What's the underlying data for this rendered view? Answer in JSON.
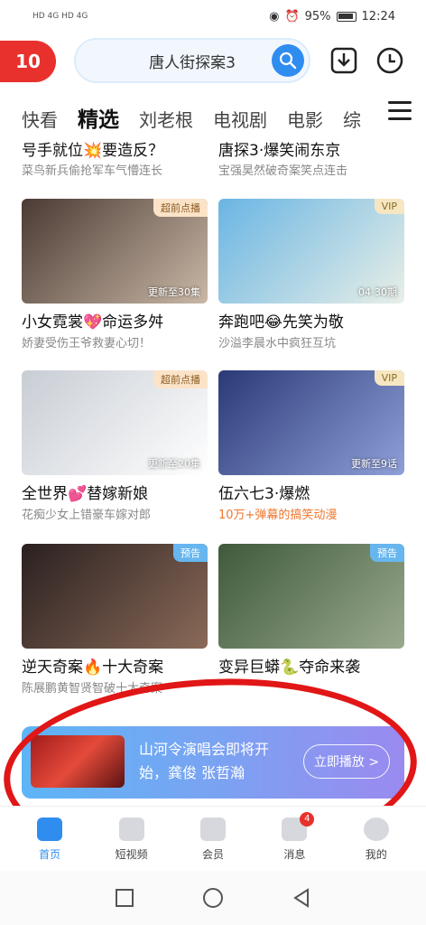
{
  "status_bar": {
    "signal_left": "HD 4G HD 4G",
    "battery_percent": "95%",
    "time": "12:24"
  },
  "header": {
    "logo_text": "10",
    "search_value": "唐人街探案3",
    "download_icon": "download-icon",
    "history_icon": "clock-icon"
  },
  "tabs": [
    {
      "label": "快看",
      "active": false
    },
    {
      "label": "精选",
      "active": true
    },
    {
      "label": "刘老根",
      "active": false
    },
    {
      "label": "电视剧",
      "active": false
    },
    {
      "label": "电影",
      "active": false
    },
    {
      "label": "综",
      "active": false
    }
  ],
  "partial_row": [
    {
      "title": "号手就位💥要造反？",
      "subtitle": "菜鸟新兵偷抢军车气懵连长"
    },
    {
      "title": "唐探3·爆笑闹东京",
      "subtitle": "宝强昊然破奇案笑点连击"
    }
  ],
  "cards": [
    {
      "badge": "超前点播",
      "badge_style": "orange",
      "overlay": "更新至30集",
      "title": "小女霓裳💖命运多舛",
      "subtitle": "娇妻受伤王爷救妻心切！",
      "thumb_colors": [
        "#4a3a33",
        "#c9b8a6"
      ]
    },
    {
      "badge": "VIP",
      "badge_style": "vip",
      "overlay": "04-30期",
      "title": "奔跑吧😂先笑为敬",
      "subtitle": "沙溢李晨水中疯狂互坑",
      "thumb_colors": [
        "#6ab5e3",
        "#e8efe7"
      ]
    },
    {
      "badge": "超前点播",
      "badge_style": "orange",
      "overlay": "更新至20集",
      "title": "全世界💕替嫁新娘",
      "subtitle": "花痴少女上错豪车嫁对郎",
      "thumb_colors": [
        "#c8cdd4",
        "#ffffff"
      ]
    },
    {
      "badge": "VIP",
      "badge_style": "vip",
      "overlay": "更新至9话",
      "title": "伍六七3·爆燃",
      "subtitle": "10万+弹幕的搞笑动漫",
      "subtitle_highlight": true,
      "thumb_colors": [
        "#2b3a77",
        "#8fa0d8"
      ]
    },
    {
      "badge": "预告",
      "badge_style": "blue",
      "overlay": "",
      "title": "逆天奇案🔥十大奇案",
      "subtitle": "陈展鹏黄智贤智破十大奇案",
      "thumb_colors": [
        "#2a2020",
        "#8a6a58"
      ]
    },
    {
      "badge": "预告",
      "badge_style": "blue",
      "overlay": "",
      "title": "变异巨蟒🐍夺命来袭",
      "subtitle": "",
      "thumb_colors": [
        "#3f5a3b",
        "#9aa98e"
      ]
    }
  ],
  "promo": {
    "text": "山河令演唱会即将开始，龚俊 张哲瀚",
    "button_label": "立即播放 >"
  },
  "bottom_nav": [
    {
      "label": "首页",
      "active": true,
      "badge": ""
    },
    {
      "label": "短视频",
      "active": false,
      "badge": ""
    },
    {
      "label": "会员",
      "active": false,
      "badge": ""
    },
    {
      "label": "消息",
      "active": false,
      "badge": "4"
    },
    {
      "label": "我的",
      "active": false,
      "badge": ""
    }
  ],
  "colors": {
    "accent": "#2f8df0",
    "brand_red": "#e8312c",
    "annotation_red": "#e11616"
  }
}
